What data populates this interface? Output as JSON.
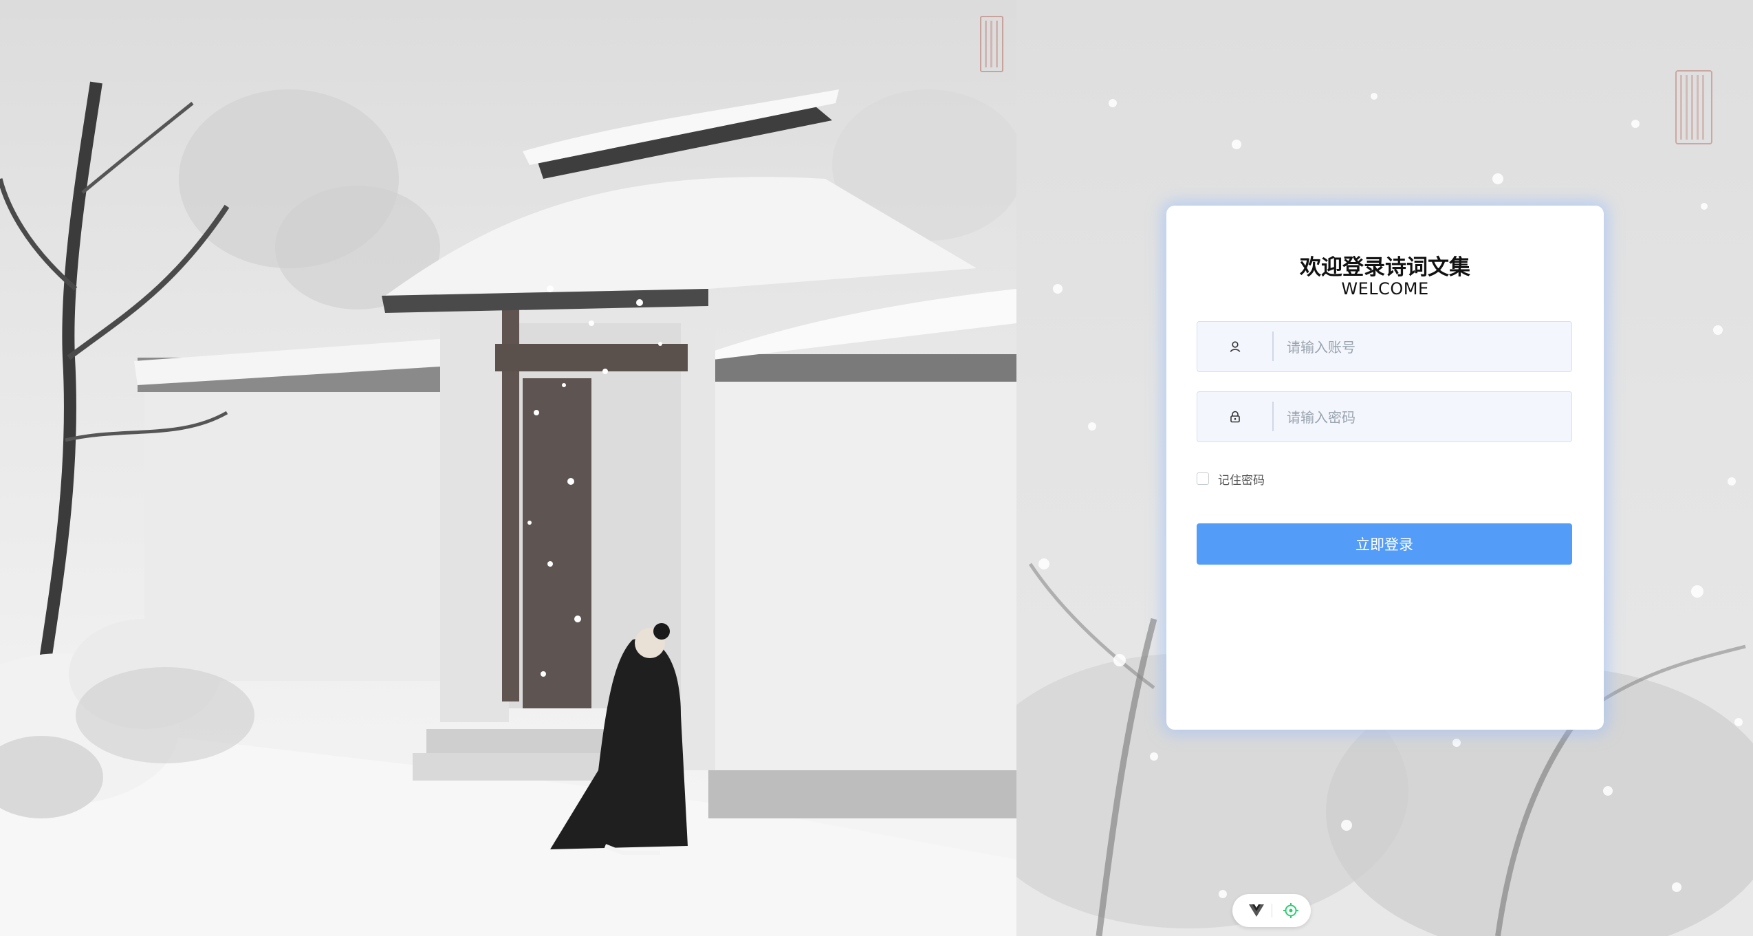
{
  "login": {
    "title": "欢迎登录诗词文集",
    "subtitle": "WELCOME",
    "username_placeholder": "请输入账号",
    "password_placeholder": "请输入密码",
    "remember_label": "记住密码",
    "remember_checked": false,
    "submit_label": "立即登录"
  },
  "icons": {
    "username": "user-icon",
    "password": "lock-icon",
    "devtools_vue": "vue-logo-icon",
    "devtools_inspect": "crosshair-icon"
  },
  "colors": {
    "primary": "#539cf8",
    "card_glow": "#96beff",
    "input_bg": "#f3f6fc"
  }
}
